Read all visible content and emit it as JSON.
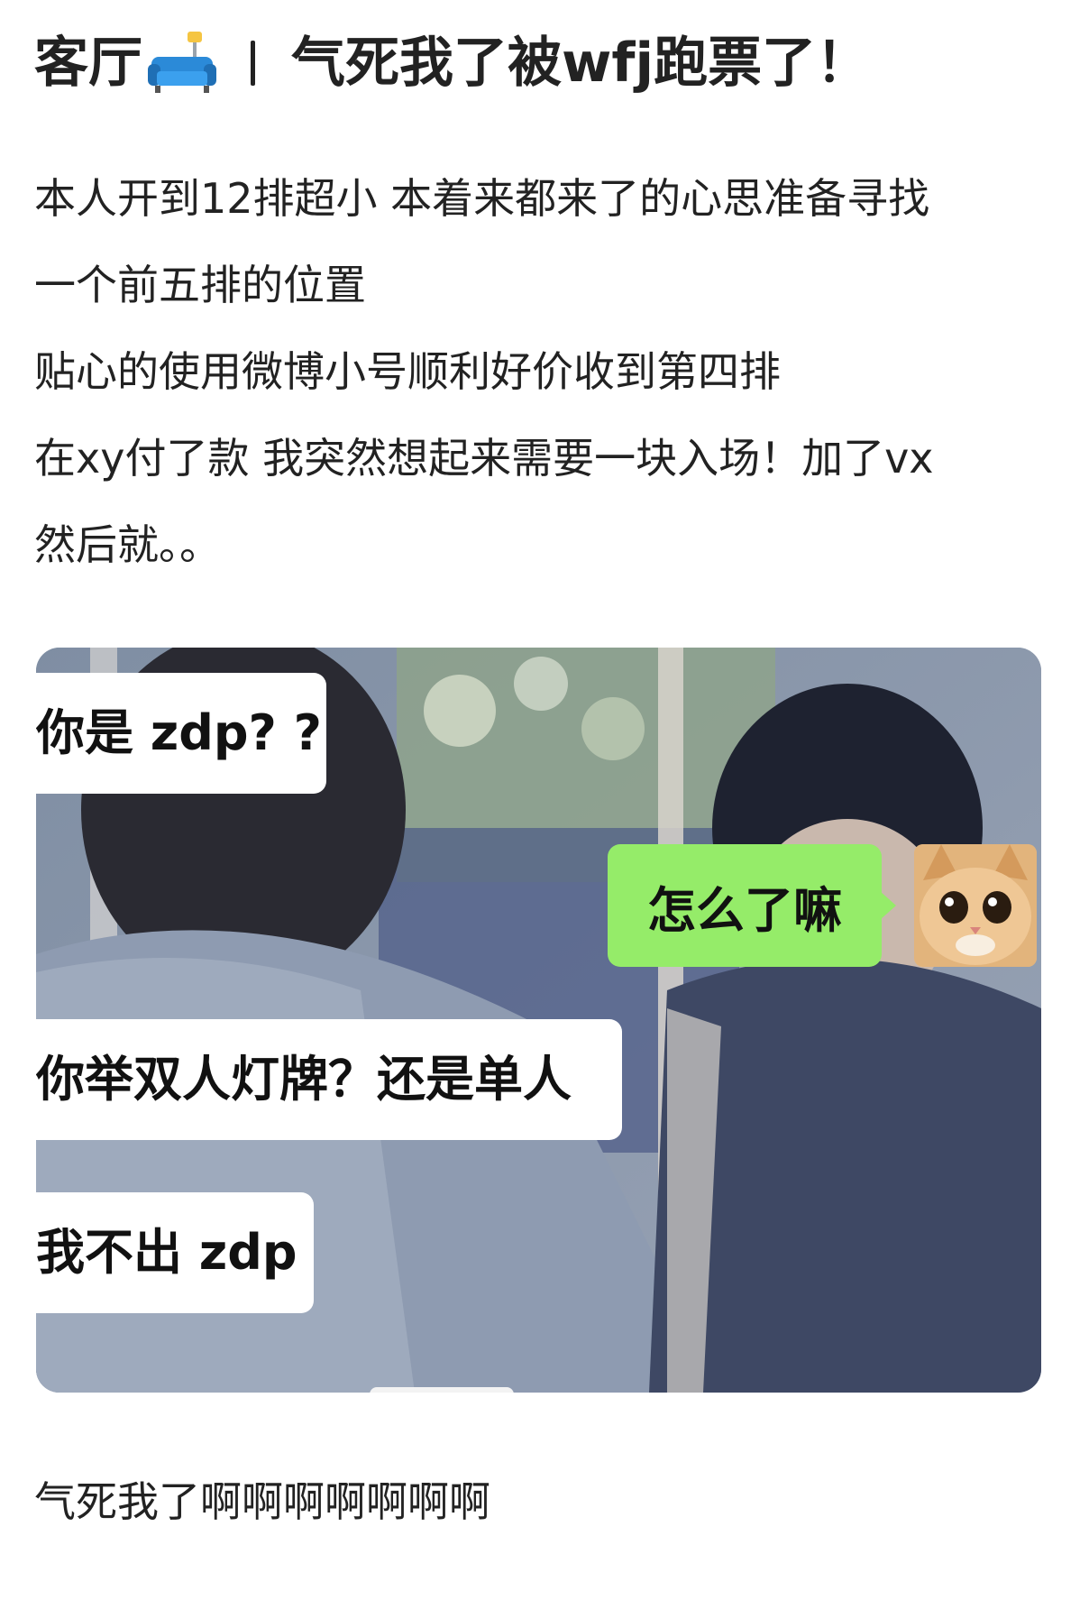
{
  "title": {
    "prefix": "客厅",
    "sofa_icon": "sofa-lamp-emoji",
    "main": "气死我了被wfj跑票了！"
  },
  "body": {
    "lines": [
      "本人开到12排超小 本着来都来了的心思准备寻找",
      "一个前五排的位置",
      "贴心的使用微博小号顺利好价收到第四排",
      "在xy付了款 我突然想起来需要一块入场！加了vx",
      "然后就。。"
    ]
  },
  "chat_screenshot": {
    "messages": [
      {
        "side": "left",
        "text": "你是 zdp? ?"
      },
      {
        "side": "right",
        "text": "怎么了嘛",
        "avatar": "cat-avatar"
      },
      {
        "side": "left",
        "text": "你举双人灯牌？还是单人"
      },
      {
        "side": "left",
        "text": "我不出 zdp"
      }
    ],
    "colors": {
      "left_bubble": "#ffffff",
      "right_bubble": "#95ec69"
    }
  },
  "footer": {
    "text": "气死我了啊啊啊啊啊啊啊"
  }
}
